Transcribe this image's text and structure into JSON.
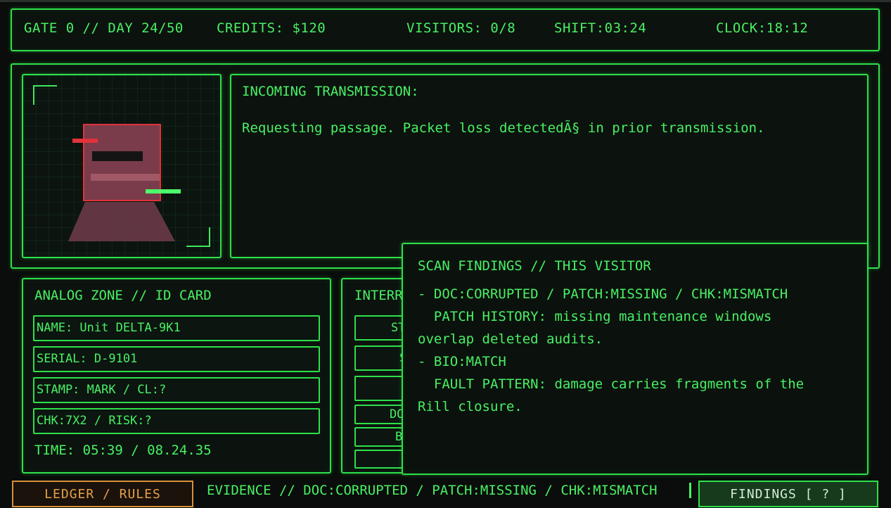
{
  "status": {
    "gate_day": "GATE 0 // DAY 24/50",
    "credits": "CREDITS: $120",
    "visitors": "VISITORS: 0/8",
    "shift": "SHIFT:03:24",
    "clock": "CLOCK:18:12"
  },
  "transmission": {
    "title": "INCOMING TRANSMISSION:",
    "body": "Requesting passage. Packet loss detectedÃ§ in prior transmission."
  },
  "id_card": {
    "title": "ANALOG ZONE // ID CARD",
    "name": "NAME: Unit DELTA-9K1",
    "serial": "SERIAL: D-9101",
    "stamp": "STAMP: MARK / CL:?",
    "chk": "CHK:7X2 / RISK:?",
    "time": "TIME: 05:39 / 08.24.35"
  },
  "interrogation": {
    "title": "INTERR",
    "buttons": [
      "ST",
      "S",
      "",
      "DO",
      "B",
      ""
    ]
  },
  "findings": {
    "title": "SCAN FINDINGS // THIS VISITOR",
    "line1": "- DOC:CORRUPTED / PATCH:MISSING / CHK:MISMATCH",
    "line2": "  PATCH HISTORY: missing maintenance windows",
    "line3": "overlap deleted audits.",
    "line4": "- BIO:MATCH",
    "line5": "  FAULT PATTERN: damage carries fragments of the",
    "line6": "Rill closure."
  },
  "bottom": {
    "ledger_label": "LEDGER / RULES",
    "evidence": "EVIDENCE // DOC:CORRUPTED / PATCH:MISSING / CHK:MISMATCH",
    "findings_label": "FINDINGS [ ? ]"
  },
  "colors": {
    "terminal_green": "#49f064",
    "border_green": "#2ee04a",
    "ledger_orange": "#e8a048",
    "visitor_red": "#e2323a"
  }
}
